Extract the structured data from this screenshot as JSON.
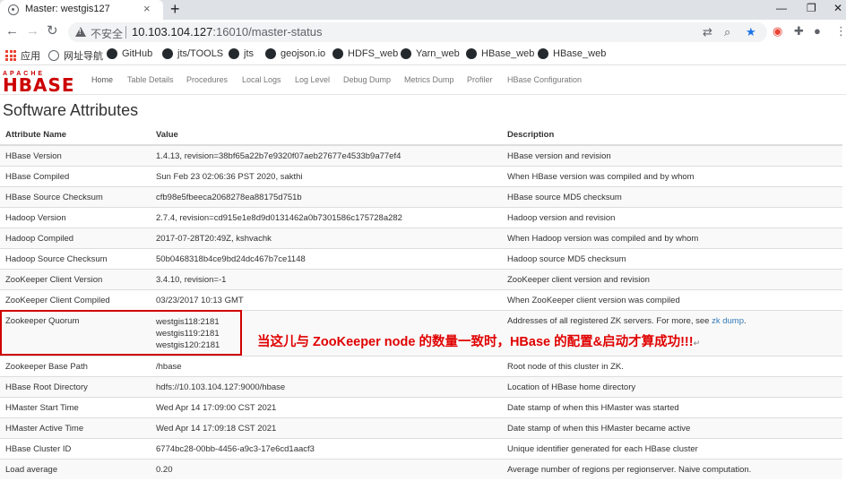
{
  "browser": {
    "tab_title": "Master: westgis127",
    "tab_close": "×",
    "new_tab": "+",
    "window_controls": [
      "—",
      "❐",
      "✕"
    ],
    "security_label": "不安全",
    "url_host": "10.103.104.127",
    "url_rest": ":16010/master-status",
    "bookmarks": [
      {
        "label": "应用",
        "icon": "apps-icon"
      },
      {
        "label": "网址导航",
        "icon": "globe-icon"
      },
      {
        "label": "GitHub",
        "icon": "github-icon"
      },
      {
        "label": "jts/TOOLS",
        "icon": "github-icon"
      },
      {
        "label": "jts",
        "icon": "github-icon"
      },
      {
        "label": "geojson.io",
        "icon": "geojson-icon"
      },
      {
        "label": "HDFS_web",
        "icon": "github-icon"
      },
      {
        "label": "Yarn_web",
        "icon": "github-icon"
      },
      {
        "label": "HBase_web",
        "icon": "github-icon"
      },
      {
        "label": "HBase_web",
        "icon": "github-icon"
      }
    ]
  },
  "logo": {
    "apache": "APACHE",
    "hbase": "HBASE"
  },
  "nav": {
    "items": [
      "Home",
      "Table Details",
      "Procedures",
      "Local Logs",
      "Log Level",
      "Debug Dump",
      "Metrics Dump",
      "Profiler",
      "HBase Configuration"
    ],
    "active": "Home"
  },
  "page_title": "Software Attributes",
  "table": {
    "headers": [
      "Attribute Name",
      "Value",
      "Description"
    ],
    "rows": [
      {
        "name": "HBase Version",
        "value": "1.4.13, revision=38bf65a22b7e9320f07aeb27677e4533b9a77ef4",
        "desc": "HBase version and revision"
      },
      {
        "name": "HBase Compiled",
        "value": "Sun Feb 23 02:06:36 PST 2020, sakthi",
        "desc": "When HBase version was compiled and by whom"
      },
      {
        "name": "HBase Source Checksum",
        "value": "cfb98e5fbeeca2068278ea88175d751b",
        "desc": "HBase source MD5 checksum"
      },
      {
        "name": "Hadoop Version",
        "value": "2.7.4, revision=cd915e1e8d9d0131462a0b7301586c175728a282",
        "desc": "Hadoop version and revision"
      },
      {
        "name": "Hadoop Compiled",
        "value": "2017-07-28T20:49Z, kshvachk",
        "desc": "When Hadoop version was compiled and by whom"
      },
      {
        "name": "Hadoop Source Checksum",
        "value": "50b0468318b4ce9bd24dc467b7ce1148",
        "desc": "Hadoop source MD5 checksum"
      },
      {
        "name": "ZooKeeper Client Version",
        "value": "3.4.10, revision=-1",
        "desc": "ZooKeeper client version and revision"
      },
      {
        "name": "ZooKeeper Client Compiled",
        "value": "03/23/2017 10:13 GMT",
        "desc": "When ZooKeeper client version was compiled"
      }
    ],
    "quorum": {
      "name": "Zookeeper Quorum",
      "servers": [
        "westgis118:2181",
        "westgis119:2181",
        "westgis120:2181"
      ],
      "desc": "Addresses of all registered ZK servers. For more, see ",
      "desc_link": "zk dump",
      "desc_end": "."
    },
    "rows2": [
      {
        "name": "Zookeeper Base Path",
        "value": "/hbase",
        "desc": "Root node of this cluster in ZK."
      },
      {
        "name": "HBase Root Directory",
        "value": "hdfs://10.103.104.127:9000/hbase",
        "desc": "Location of HBase home directory"
      },
      {
        "name": "HMaster Start Time",
        "value": "Wed Apr 14 17:09:00 CST 2021",
        "desc": "Date stamp of when this HMaster was started"
      },
      {
        "name": "HMaster Active Time",
        "value": "Wed Apr 14 17:09:18 CST 2021",
        "desc": "Date stamp of when this HMaster became active"
      },
      {
        "name": "HBase Cluster ID",
        "value": "6774bc28-00bb-4456-a9c3-17e6cd1aacf3",
        "desc": "Unique identifier generated for each HBase cluster"
      },
      {
        "name": "Load average",
        "value": "0.20",
        "desc": "Average number of regions per regionserver. Naive computation."
      }
    ]
  },
  "annotation": {
    "text": "当这儿与 ZooKeeper node 的数量一致时，HBase 的配置&启动才算成功!!!",
    "mark": "↵",
    "color": "#e00000"
  }
}
